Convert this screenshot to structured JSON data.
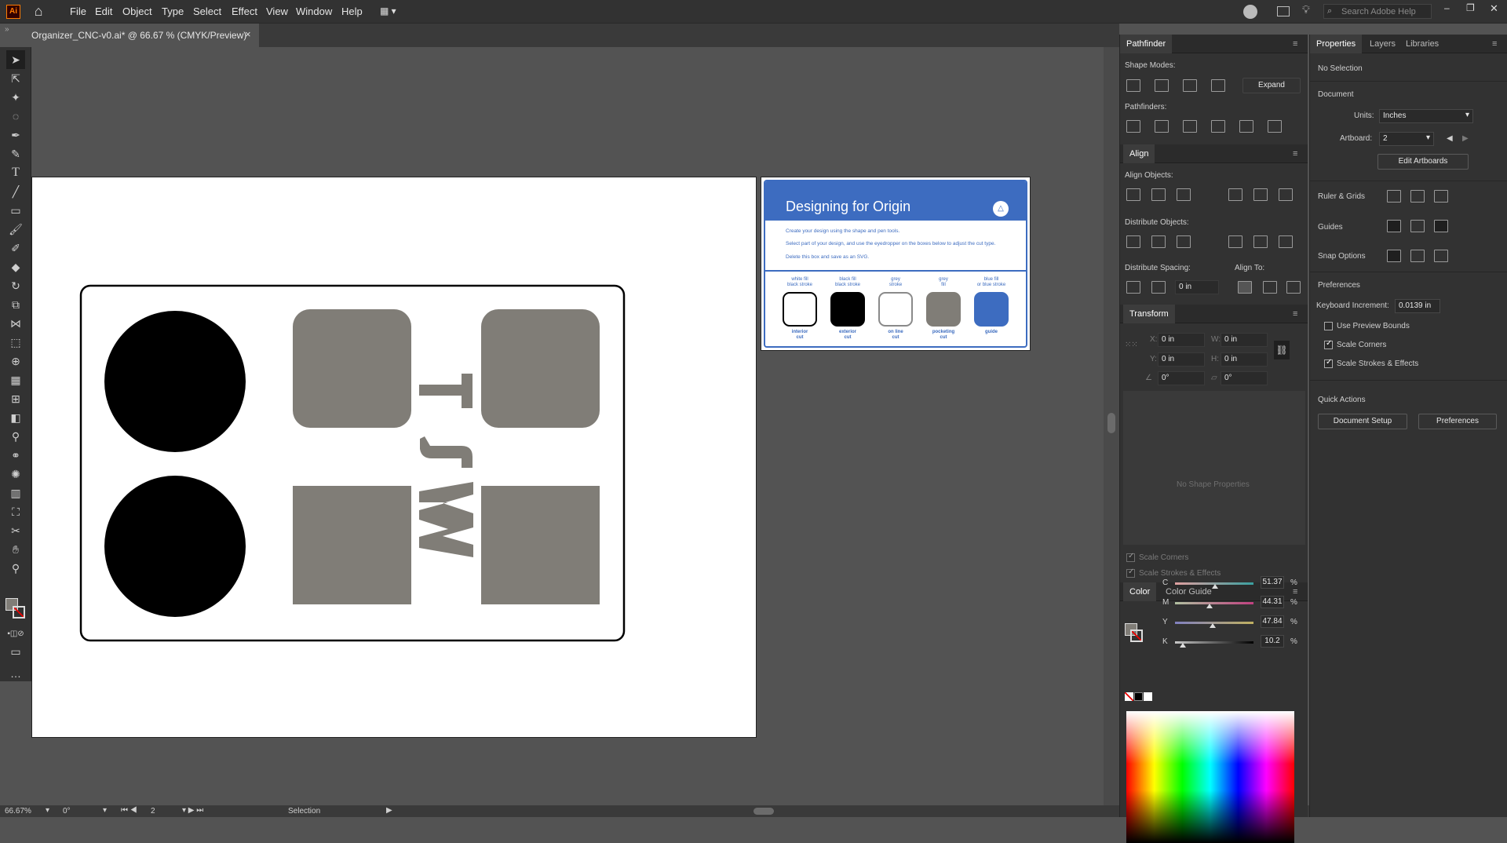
{
  "app": {
    "logo": "Ai"
  },
  "menu": [
    "File",
    "Edit",
    "Object",
    "Type",
    "Select",
    "Effect",
    "View",
    "Window",
    "Help"
  ],
  "search": {
    "placeholder": "Search Adobe Help"
  },
  "document_tab": {
    "title": "Organizer_CNC-v0.ai* @ 66.67 % (CMYK/Preview)",
    "close": "×"
  },
  "artboard2": {
    "title": "Designing for Origin",
    "lines": [
      "Create your design using the shape and pen tools.",
      "Select part of your design, and use the eyedropper on the boxes below to adjust the cut type.",
      "Delete this box and  save  as an SVG."
    ],
    "swatches": [
      {
        "top": "white fill\nblack stroke",
        "bottom": "interior\ncut",
        "fill": "#ffffff",
        "stroke": "#000000"
      },
      {
        "top": "black fill\nblack stroke",
        "bottom": "exterior\ncut",
        "fill": "#000000",
        "stroke": "#000000"
      },
      {
        "top": "grey\nstroke",
        "bottom": "on line\ncut",
        "fill": "#ffffff",
        "stroke": "#8a8a8a"
      },
      {
        "top": "grey\nfill",
        "bottom": "pocketing\ncut",
        "fill": "#807d77",
        "stroke": "#807d77"
      },
      {
        "top": "blue fill\nor blue stroke",
        "bottom": "guide",
        "fill": "#3d6cc0",
        "stroke": "#3d6cc0"
      }
    ]
  },
  "status": {
    "zoom": "66.67%",
    "rotation": "0°",
    "artboard": "2",
    "tool": "Selection"
  },
  "pathfinder": {
    "tab": "Pathfinder",
    "shape_modes": "Shape Modes:",
    "expand": "Expand",
    "pathfinders": "Pathfinders:"
  },
  "align": {
    "tab": "Align",
    "objects": "Align Objects:",
    "distribute": "Distribute Objects:",
    "spacing": "Distribute Spacing:",
    "align_to": "Align To:",
    "spacing_value": "0 in"
  },
  "transform": {
    "tab": "Transform",
    "x_label": "X:",
    "x": "0 in",
    "y_label": "Y:",
    "y": "0 in",
    "w_label": "W:",
    "w": "0 in",
    "h_label": "H:",
    "h": "0 in",
    "rot": "0°",
    "shear": "0°",
    "no_shape": "No Shape Properties",
    "scale_corners": "Scale Corners",
    "scale_strokes": "Scale Strokes & Effects"
  },
  "color": {
    "tab": "Color",
    "tab2": "Color Guide",
    "channels": [
      {
        "k": "C",
        "v": "51.37",
        "pct": 51.37
      },
      {
        "k": "M",
        "v": "44.31",
        "pct": 44.31
      },
      {
        "k": "Y",
        "v": "47.84",
        "pct": 47.84
      },
      {
        "k": "K",
        "v": "10.2",
        "pct": 10.2
      }
    ],
    "unit": "%"
  },
  "properties": {
    "tabs": [
      "Properties",
      "Layers",
      "Libraries"
    ],
    "no_selection": "No Selection",
    "document": "Document",
    "units_label": "Units:",
    "units": "Inches",
    "artboard_label": "Artboard:",
    "artboard": "2",
    "edit_artboards": "Edit Artboards",
    "ruler_grids": "Ruler & Grids",
    "guides": "Guides",
    "snap_options": "Snap Options",
    "preferences": "Preferences",
    "kb_label": "Keyboard Increment:",
    "kb": "0.0139 in",
    "use_preview": "Use Preview Bounds",
    "scale_corners": "Scale Corners",
    "scale_strokes": "Scale Strokes & Effects",
    "quick_actions": "Quick Actions",
    "doc_setup": "Document Setup",
    "prefs_btn": "Preferences"
  },
  "colors": {
    "grey_shape": "#807d77",
    "accent_blue": "#3d6cc0"
  }
}
